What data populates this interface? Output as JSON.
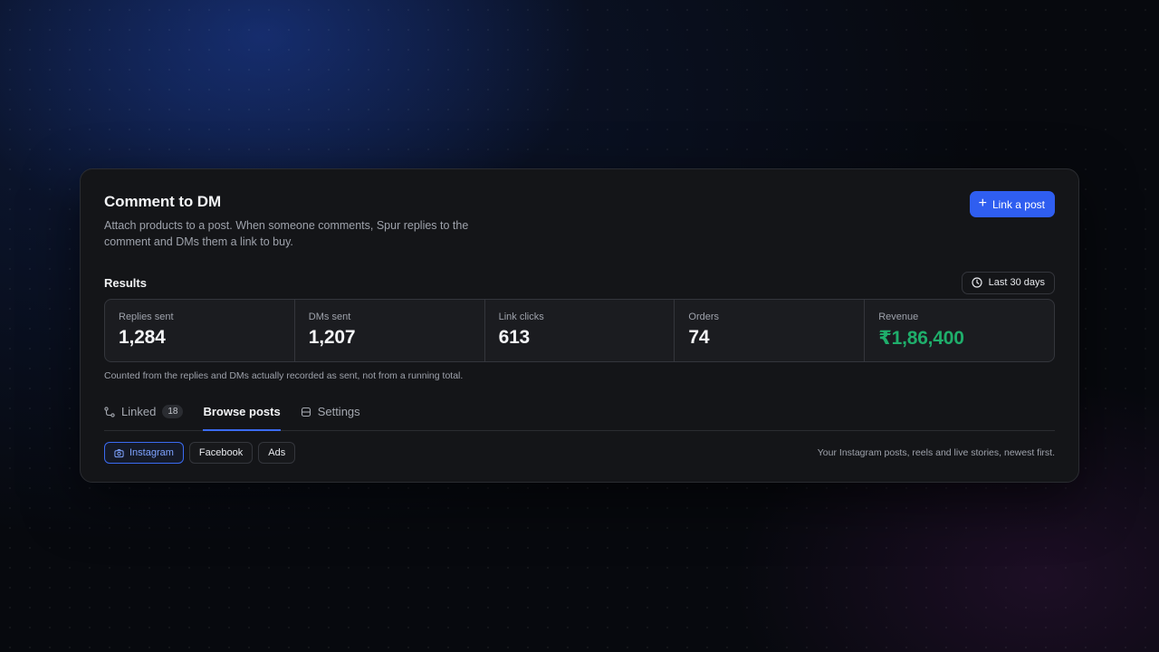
{
  "header": {
    "title": "Comment to DM",
    "subtitle": "Attach products to a post. When someone comments, Spur replies to the comment and DMs them a link to buy.",
    "primary_button": "Link a post"
  },
  "results": {
    "title": "Results",
    "range_label": "Last 30 days",
    "stats": [
      {
        "label": "Replies sent",
        "value": "1,284"
      },
      {
        "label": "DMs sent",
        "value": "1,207"
      },
      {
        "label": "Link clicks",
        "value": "613"
      },
      {
        "label": "Orders",
        "value": "74"
      },
      {
        "label": "Revenue",
        "value": "₹1,86,400"
      }
    ],
    "note": "Counted from the replies and DMs actually recorded as sent, not from a running total."
  },
  "tabs": [
    {
      "label": "Linked",
      "count": "18",
      "icon": "route-icon"
    },
    {
      "label": "Browse posts",
      "active": true
    },
    {
      "label": "Settings",
      "icon": "settings-panel-icon"
    }
  ],
  "filters": {
    "chips": [
      {
        "label": "Instagram",
        "active": true,
        "icon": "camera-icon"
      },
      {
        "label": "Facebook"
      },
      {
        "label": "Ads"
      }
    ],
    "hint": "Your Instagram posts, reels and live stories, newest first."
  },
  "colors": {
    "accent": "#2f5ef0",
    "revenue": "#1fae6b",
    "card_bg": "#141518"
  }
}
